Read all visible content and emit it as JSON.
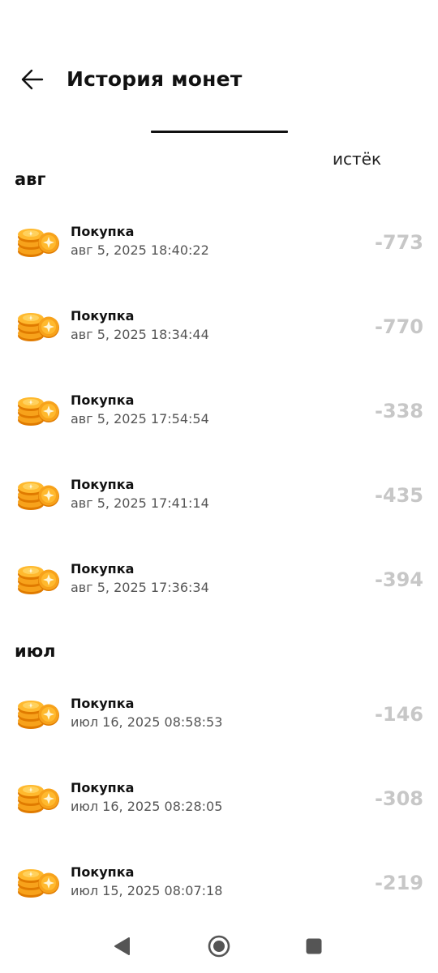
{
  "header": {
    "title": "История монет"
  },
  "tabs": {
    "expired_label": "истёк"
  },
  "groups": [
    {
      "month": "авг",
      "items": [
        {
          "title": "Покупка",
          "date": "авг 5, 2025 18:40:22",
          "amount": "-773"
        },
        {
          "title": "Покупка",
          "date": "авг 5, 2025 18:34:44",
          "amount": "-770"
        },
        {
          "title": "Покупка",
          "date": "авг 5, 2025 17:54:54",
          "amount": "-338"
        },
        {
          "title": "Покупка",
          "date": "авг 5, 2025 17:41:14",
          "amount": "-435"
        },
        {
          "title": "Покупка",
          "date": "авг 5, 2025 17:36:34",
          "amount": "-394"
        }
      ]
    },
    {
      "month": "июл",
      "items": [
        {
          "title": "Покупка",
          "date": "июл 16, 2025 08:58:53",
          "amount": "-146"
        },
        {
          "title": "Покупка",
          "date": "июл 16, 2025 08:28:05",
          "amount": "-308"
        },
        {
          "title": "Покупка",
          "date": "июл 15, 2025 08:07:18",
          "amount": "-219"
        }
      ]
    }
  ],
  "icons": {
    "back": "arrow-left-icon",
    "coin": "coin-stack-icon",
    "nav_back": "triangle-back-icon",
    "nav_home": "circle-home-icon",
    "nav_recents": "square-recents-icon"
  },
  "colors": {
    "amount": "#c7c7c7",
    "coin_main": "#f7a21b",
    "coin_light": "#ffd15c",
    "coin_dark": "#e07b00"
  }
}
